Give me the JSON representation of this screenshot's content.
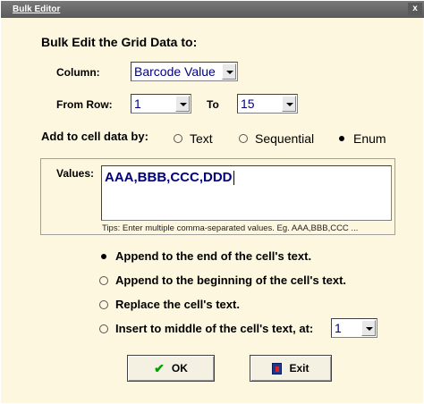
{
  "window": {
    "title": "Bulk Editor",
    "close_label": "x"
  },
  "heading": "Bulk Edit the Grid Data to:",
  "column": {
    "label": "Column:",
    "value": "Barcode Value"
  },
  "rows": {
    "from_label": "From Row:",
    "from_value": "1",
    "to_label": "To",
    "to_value": "15"
  },
  "add_by": {
    "label": "Add to cell data by:",
    "options": [
      {
        "label": "Text",
        "selected": false
      },
      {
        "label": "Sequential",
        "selected": false
      },
      {
        "label": "Enum",
        "selected": true
      }
    ]
  },
  "values": {
    "label": "Values:",
    "text": "AAA,BBB,CCC,DDD",
    "tips": "Tips: Enter multiple comma-separated values.  Eg.  AAA,BBB,CCC ..."
  },
  "modes": [
    {
      "label": "Append to the end of the cell's text.",
      "selected": true
    },
    {
      "label": "Append to the beginning of the cell's text.",
      "selected": false
    },
    {
      "label": "Replace the cell's text.",
      "selected": false
    },
    {
      "label": "Insert to middle of the cell's text, at:",
      "selected": false
    }
  ],
  "insert_position": "1",
  "buttons": {
    "ok": "OK",
    "exit": "Exit"
  },
  "colors": {
    "title_bar": "#5a5a5a",
    "background": "#fdf7df",
    "value_text": "#000080",
    "ok_check": "#00a000"
  }
}
